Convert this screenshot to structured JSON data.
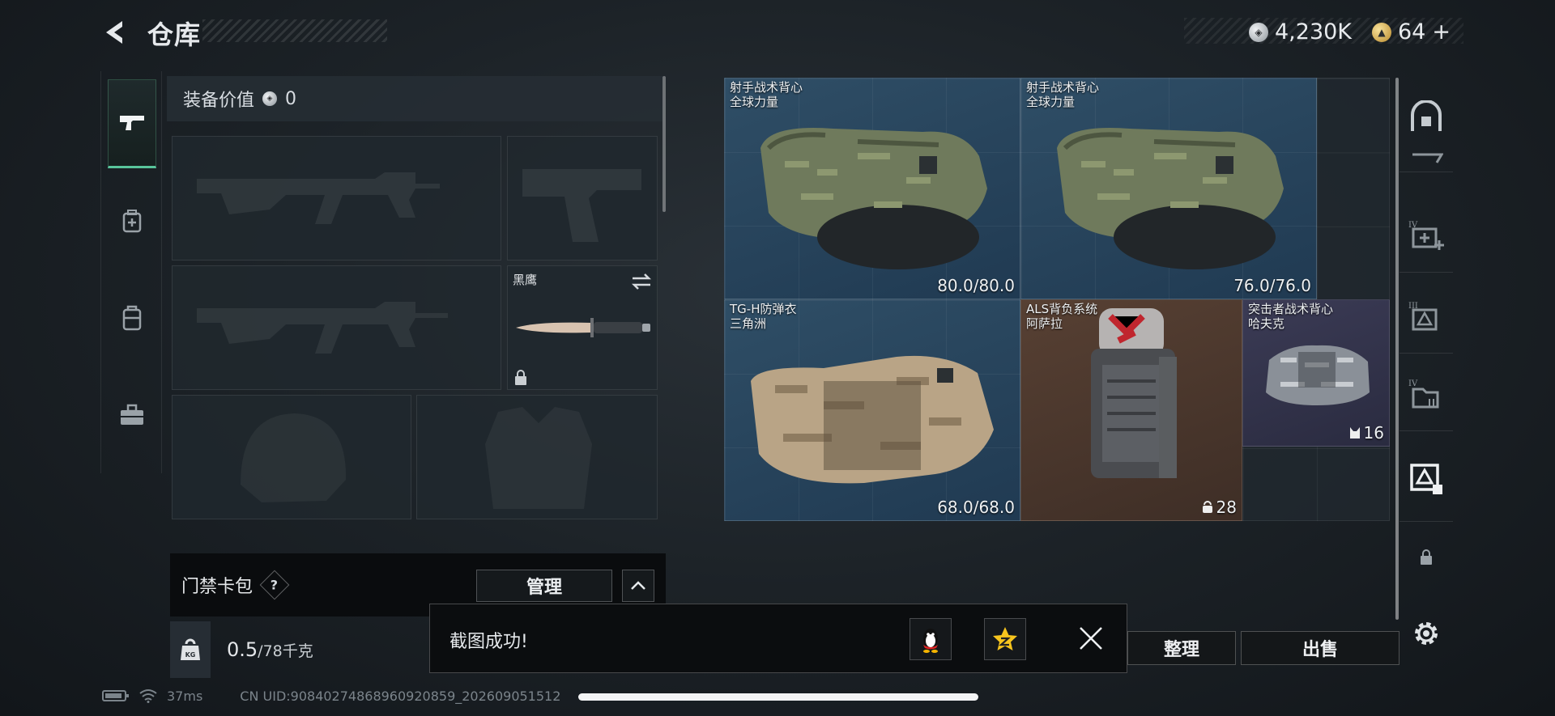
{
  "header": {
    "title": "仓库"
  },
  "currency": {
    "silver_value": "4,230K",
    "gold_value": "64",
    "add_symbol": "+"
  },
  "loadout": {
    "equip_value_label": "装备价值",
    "equip_value": "0",
    "melee_label": "黑鹰"
  },
  "card_pack": {
    "label": "门禁卡包",
    "help": "?",
    "manage_label": "管理"
  },
  "weight": {
    "icon_text": "KG",
    "current": "0.5",
    "max": "/78千克"
  },
  "stash_items": [
    {
      "name": "射手战术背心",
      "sub": "全球力量",
      "value": "80.0/80.0",
      "kind": "vest"
    },
    {
      "name": "射手战术背心",
      "sub": "全球力量",
      "value": "76.0/76.0",
      "kind": "vest"
    },
    {
      "name": "TG-H防弹衣",
      "sub": "三角洲",
      "value": "68.0/68.0",
      "kind": "armor"
    },
    {
      "name": "ALS背负系统",
      "sub": "阿萨拉",
      "value": "28",
      "kind": "backpack"
    },
    {
      "name": "突击者战术背心",
      "sub": "哈夫克",
      "value": "16",
      "kind": "rig"
    }
  ],
  "bottom_buttons": {
    "sort_label": "整理",
    "sell_label": "出售"
  },
  "toast": {
    "message": "截图成功!"
  },
  "status": {
    "ping": "37ms",
    "uid": "CN UID:908402748689609208​59_202609051512"
  },
  "colors": {
    "accent_green": "#58c59b",
    "tile_blue": "#2f4e66",
    "tile_brown": "#574033",
    "tile_purple": "#3b3b55"
  }
}
